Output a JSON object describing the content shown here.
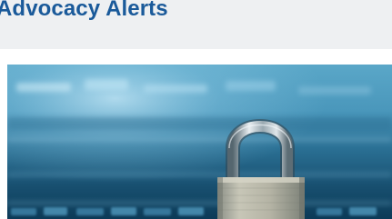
{
  "section": {
    "title": "Advocacy Alerts",
    "title_color": "#1a5a9a"
  },
  "colors": {
    "header_bg": "#eef0f2",
    "photo_tint": "#2f7da6"
  },
  "image": {
    "subject": "padlock-icon"
  }
}
